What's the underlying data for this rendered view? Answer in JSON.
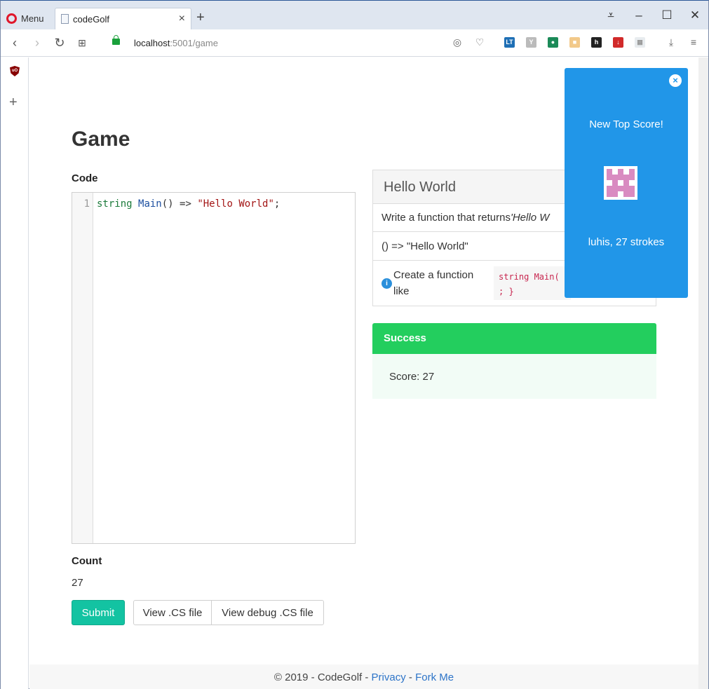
{
  "browser": {
    "menu_label": "Menu",
    "tab_title": "codeGolf",
    "url_host": "localhost",
    "url_rest": ":5001/game"
  },
  "page": {
    "title": "Game",
    "code_label": "Code",
    "code": {
      "line_number": "1",
      "tokens": {
        "kw": "string",
        "fn": "Main",
        "mid": "() => ",
        "str": "\"Hello World\"",
        "end": ";"
      }
    },
    "count_label": "Count",
    "count_value": "27",
    "buttons": {
      "submit": "Submit",
      "view_cs": "View .CS file",
      "view_debug_cs": "View debug .CS file"
    },
    "challenge": {
      "title": "Hello World",
      "description_prefix": "Write a function that returns ",
      "description_em": "'Hello W",
      "signature": "() => \"Hello World\"",
      "hint_text": "Create a function like",
      "hint_code_1": "string Main(",
      "hint_code_2": "; }"
    },
    "success": {
      "title": "Success",
      "score_text": "Score: 27"
    },
    "footer": {
      "copyright": "© 2019 - CodeGolf - ",
      "privacy": "Privacy",
      "sep": " - ",
      "fork": "Fork Me"
    }
  },
  "toast": {
    "close": "×",
    "title": "New Top Score!",
    "subtitle": "luhis, 27 strokes",
    "avatar_color": "#d98bc1"
  }
}
